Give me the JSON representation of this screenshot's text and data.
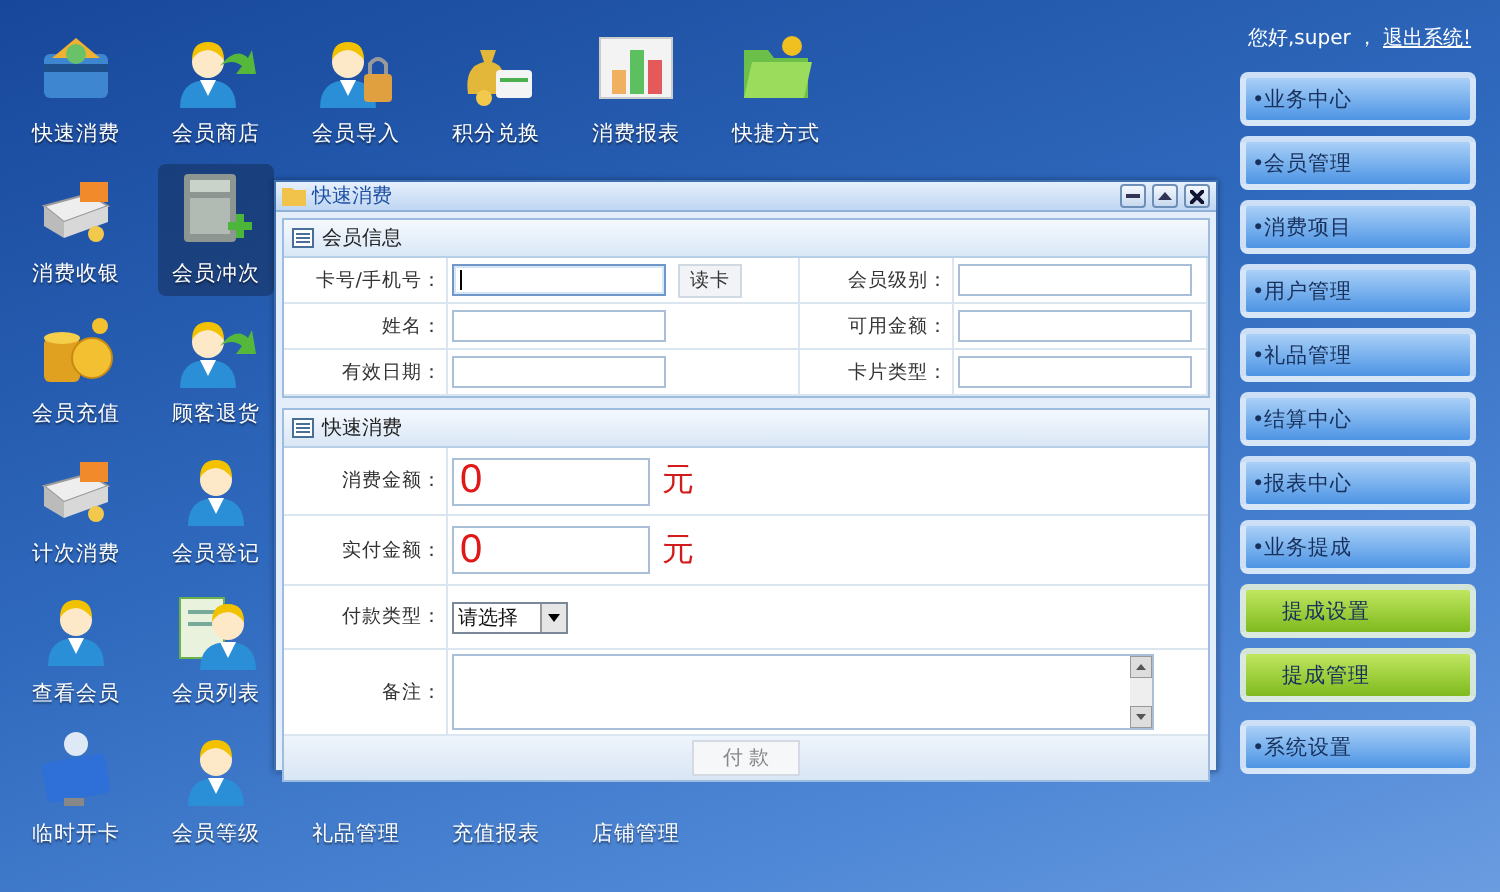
{
  "desktop": {
    "rows": [
      [
        {
          "label": "快速消费",
          "kind": "card",
          "selected": false
        },
        {
          "label": "会员商店",
          "kind": "person-arrow",
          "selected": false
        },
        {
          "label": "会员导入",
          "kind": "person-lock",
          "selected": false
        },
        {
          "label": "积分兑换",
          "kind": "money",
          "selected": false
        },
        {
          "label": "消费报表",
          "kind": "chart",
          "selected": false
        },
        {
          "label": "快捷方式",
          "kind": "folder",
          "selected": false
        }
      ],
      [
        {
          "label": "消费收银",
          "kind": "register",
          "selected": false
        },
        {
          "label": "会员冲次",
          "kind": "calculator",
          "selected": true
        }
      ],
      [
        {
          "label": "会员充值",
          "kind": "coins",
          "selected": false
        },
        {
          "label": "顾客退货",
          "kind": "person-arrow",
          "selected": false
        }
      ],
      [
        {
          "label": "计次消费",
          "kind": "register",
          "selected": false
        },
        {
          "label": "会员登记",
          "kind": "person",
          "selected": false
        }
      ],
      [
        {
          "label": "查看会员",
          "kind": "person",
          "selected": false
        },
        {
          "label": "会员列表",
          "kind": "person-list",
          "selected": false
        }
      ],
      [
        {
          "label": "临时开卡",
          "kind": "person-card",
          "selected": false
        },
        {
          "label": "会员等级",
          "kind": "person",
          "selected": false
        },
        {
          "label": "礼品管理",
          "kind": "covered",
          "selected": false
        },
        {
          "label": "充值报表",
          "kind": "covered",
          "selected": false
        },
        {
          "label": "店铺管理",
          "kind": "covered",
          "selected": false
        }
      ]
    ]
  },
  "user_bar": {
    "greeting": "您好,super ，",
    "logout": "退出系统!"
  },
  "menu": [
    {
      "label": "•业务中心",
      "kind": "group"
    },
    {
      "label": "•会员管理",
      "kind": "group"
    },
    {
      "label": "•消费项目",
      "kind": "group"
    },
    {
      "label": "•用户管理",
      "kind": "group"
    },
    {
      "label": "•礼品管理",
      "kind": "group"
    },
    {
      "label": "•结算中心",
      "kind": "group"
    },
    {
      "label": "•报表中心",
      "kind": "group"
    },
    {
      "label": "•业务提成",
      "kind": "group"
    },
    {
      "label": "提成设置",
      "kind": "sub"
    },
    {
      "label": "提成管理",
      "kind": "sub"
    },
    {
      "label": "•系统设置",
      "kind": "group"
    }
  ],
  "dialog": {
    "title": "快速消费",
    "member_info": {
      "title": "会员信息",
      "rows": [
        {
          "left": {
            "label": "卡号/手机号：",
            "focused": true,
            "action": "读卡"
          },
          "right": {
            "label": "会员级别："
          }
        },
        {
          "left": {
            "label": "姓名：",
            "focused": false
          },
          "right": {
            "label": "可用金额："
          }
        },
        {
          "left": {
            "label": "有效日期：",
            "focused": false
          },
          "right": {
            "label": "卡片类型："
          }
        }
      ]
    },
    "quick_pay": {
      "title": "快速消费",
      "rows": [
        {
          "kind": "amount",
          "label": "消费金额：",
          "value": "0",
          "unit": "元"
        },
        {
          "kind": "amount",
          "label": "实付金额：",
          "value": "0",
          "unit": "元"
        },
        {
          "kind": "select",
          "label": "付款类型：",
          "value": "请选择"
        },
        {
          "kind": "textarea",
          "label": "备注："
        }
      ]
    },
    "submit": "付 款"
  }
}
